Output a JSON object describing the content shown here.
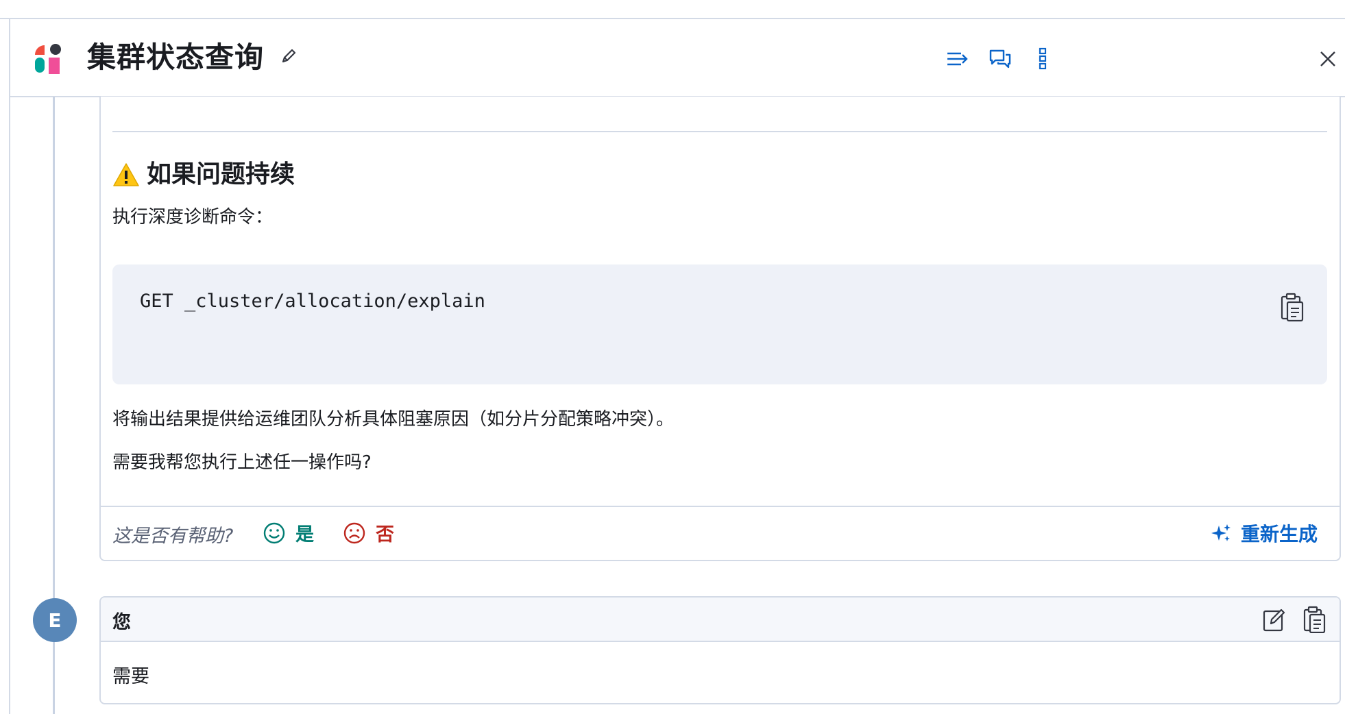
{
  "header": {
    "title": "集群状态查询",
    "icons": [
      "pencil-icon",
      "collapse-lines-icon",
      "chat-bubbles-icon",
      "kebab-menu-icon",
      "close-icon"
    ]
  },
  "assistant_message": {
    "warning_heading": "如果问题持续",
    "intro": "执行深度诊断命令：",
    "code": "GET _cluster/allocation/explain",
    "followup": "将输出结果提供给运维团队分析具体阻塞原因（如分片分配策略冲突）。",
    "question": "需要我帮您执行上述任一操作吗?"
  },
  "feedback": {
    "prompt": "这是否有帮助?",
    "yes_label": "是",
    "no_label": "否",
    "regenerate_label": "重新生成"
  },
  "user_message": {
    "avatar_initial": "E",
    "author": "您",
    "text": "需要"
  },
  "colors": {
    "accent": "#0b64c9",
    "success": "#017d73",
    "danger": "#bd271e",
    "avatar": "#5887b8",
    "border": "#d3dae6",
    "code_bg": "#eef1f8"
  }
}
